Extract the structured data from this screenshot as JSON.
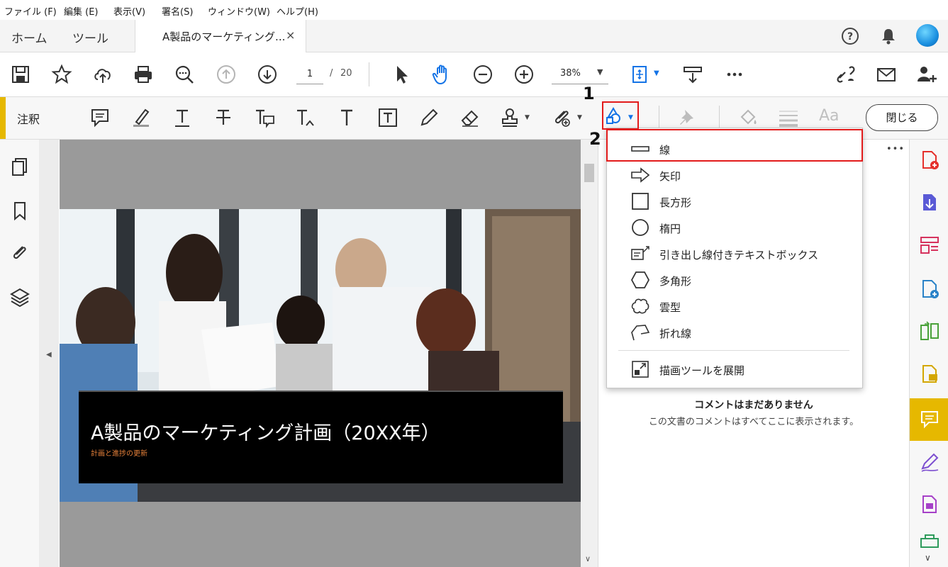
{
  "menu": [
    "ファイル (F)",
    "編集 (E)",
    "表示(V)",
    "署名(S)",
    "ウィンドウ(W)",
    "ヘルプ(H)"
  ],
  "tabs": {
    "home": "ホーム",
    "tools": "ツール",
    "document": "A製品のマーケティング...",
    "close": "×"
  },
  "toolbar": {
    "page_current": "1",
    "page_separator": "/",
    "page_total": "20",
    "zoom": "38%"
  },
  "comment_bar": {
    "label": "注釈",
    "text_style": "Aa",
    "close_button": "閉じる"
  },
  "slide": {
    "title": "A製品のマーケティング計画（20XX年）",
    "subtitle": "計画と進捗の更新"
  },
  "dropdown": {
    "items": [
      "線",
      "矢印",
      "長方形",
      "楕円",
      "引き出し線付きテキストボックス",
      "多角形",
      "雲型",
      "折れ線"
    ],
    "expand": "描画ツールを展開"
  },
  "annotations": {
    "step1": "1",
    "step2": "2"
  },
  "comments_panel": {
    "more": "•••",
    "empty_title": "コメントはまだありません",
    "empty_desc": "この文書のコメントはすべてここに表示されます。"
  },
  "colors": {
    "accent": "#e6b800",
    "highlight_red": "#e21b1b",
    "blue_tool": "#1473e6",
    "subtitle_orange": "#e8823a"
  }
}
